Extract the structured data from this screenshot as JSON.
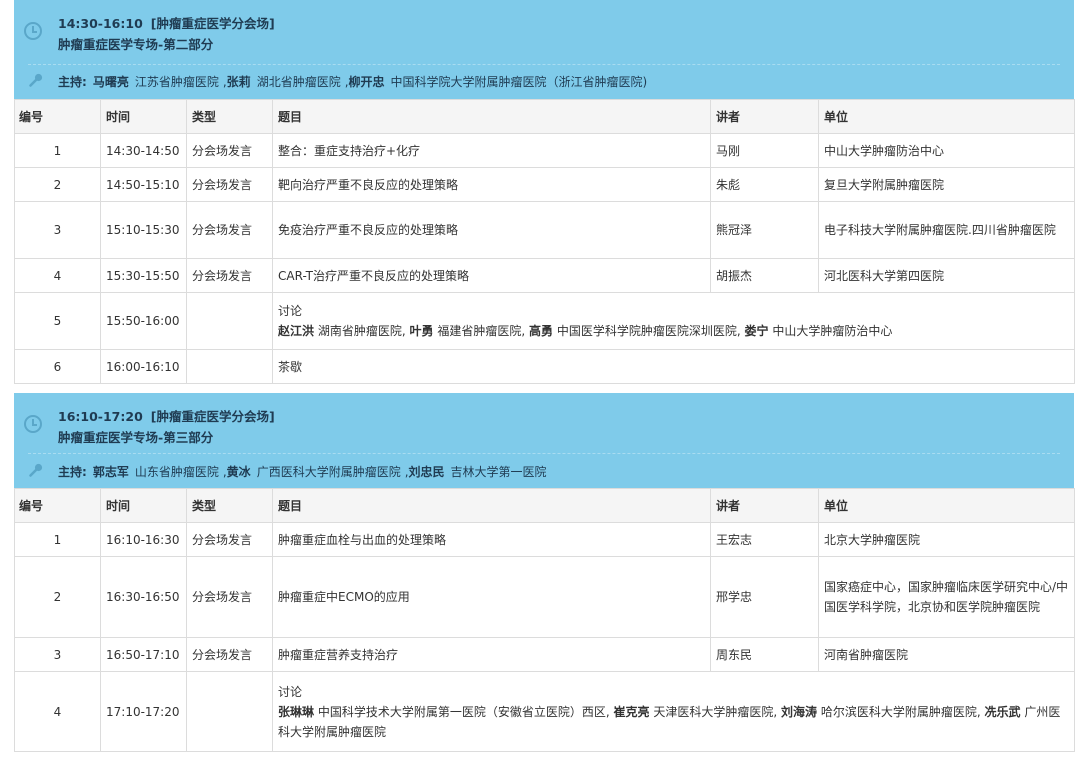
{
  "sessions": [
    {
      "time_range": "14:30-16:10",
      "venue": "[肿瘤重症医学分会场]",
      "subtitle": "肿瘤重症医学专场-第二部分",
      "host_label": "主持:",
      "hosts": [
        {
          "name": "马曙亮",
          "org": "江苏省肿瘤医院",
          "sep": ","
        },
        {
          "name": "张莉",
          "org": "湖北省肿瘤医院",
          "sep": ","
        },
        {
          "name": "柳开忠",
          "org": "中国科学院大学附属肿瘤医院（浙江省肿瘤医院)",
          "sep": ""
        }
      ],
      "headers": [
        "编号",
        "时间",
        "类型",
        "题目",
        "讲者",
        "单位"
      ],
      "rows": [
        {
          "no": "1",
          "time": "14:30-14:50",
          "type": "分会场发言",
          "topic": "整合：重症支持治疗+化疗",
          "speaker": "马刚",
          "org": "中山大学肿瘤防治中心"
        },
        {
          "no": "2",
          "time": "14:50-15:10",
          "type": "分会场发言",
          "topic": "靶向治疗严重不良反应的处理策略",
          "speaker": "朱彪",
          "org": "复旦大学附属肿瘤医院"
        },
        {
          "no": "3",
          "time": "15:10-15:30",
          "type": "分会场发言",
          "topic": "免疫治疗严重不良反应的处理策略",
          "speaker": "熊冠泽",
          "org": "电子科技大学附属肿瘤医院.四川省肿瘤医院"
        },
        {
          "no": "4",
          "time": "15:30-15:50",
          "type": "分会场发言",
          "topic": "CAR-T治疗严重不良反应的处理策略",
          "speaker": "胡振杰",
          "org": "河北医科大学第四医院"
        },
        {
          "no": "5",
          "time": "15:50-16:00",
          "type": "",
          "topic": "讨论",
          "speaker": "",
          "org": "",
          "discussants": [
            {
              "name": "赵江洪",
              "org": "湖南省肿瘤医院",
              "sep": ","
            },
            {
              "name": "叶勇",
              "org": "福建省肿瘤医院",
              "sep": ","
            },
            {
              "name": "高勇",
              "org": "中国医学科学院肿瘤医院深圳医院",
              "sep": ","
            },
            {
              "name": "娄宁",
              "org": "中山大学肿瘤防治中心",
              "sep": ""
            }
          ]
        },
        {
          "no": "6",
          "time": "16:00-16:10",
          "type": "",
          "topic": "茶歇",
          "speaker": "",
          "org": ""
        }
      ]
    },
    {
      "time_range": "16:10-17:20",
      "venue": "[肿瘤重症医学分会场]",
      "subtitle": "肿瘤重症医学专场-第三部分",
      "host_label": "主持:",
      "hosts": [
        {
          "name": "郭志军",
          "org": "山东省肿瘤医院",
          "sep": ","
        },
        {
          "name": "黄冰",
          "org": "广西医科大学附属肿瘤医院",
          "sep": ","
        },
        {
          "name": "刘忠民",
          "org": "吉林大学第一医院",
          "sep": ""
        }
      ],
      "headers": [
        "编号",
        "时间",
        "类型",
        "题目",
        "讲者",
        "单位"
      ],
      "rows": [
        {
          "no": "1",
          "time": "16:10-16:30",
          "type": "分会场发言",
          "topic": "肿瘤重症血栓与出血的处理策略",
          "speaker": "王宏志",
          "org": "北京大学肿瘤医院"
        },
        {
          "no": "2",
          "time": "16:30-16:50",
          "type": "分会场发言",
          "topic": "肿瘤重症中ECMO的应用",
          "speaker": "邢学忠",
          "org": "国家癌症中心，国家肿瘤临床医学研究中心/中国医学科学院，北京协和医学院肿瘤医院"
        },
        {
          "no": "3",
          "time": "16:50-17:10",
          "type": "分会场发言",
          "topic": "肿瘤重症营养支持治疗",
          "speaker": "周东民",
          "org": "河南省肿瘤医院"
        },
        {
          "no": "4",
          "time": "17:10-17:20",
          "type": "",
          "topic": "讨论",
          "speaker": "",
          "org": "",
          "discussants": [
            {
              "name": "张琳琳",
              "org": "中国科学技术大学附属第一医院（安徽省立医院）西区",
              "sep": ","
            },
            {
              "name": "崔克亮",
              "org": "天津医科大学肿瘤医院",
              "sep": ","
            },
            {
              "name": "刘海涛",
              "org": "哈尔滨医科大学附属肿瘤医院",
              "sep": ","
            },
            {
              "name": "冼乐武",
              "org": "广州医科大学附属肿瘤医院",
              "sep": ""
            }
          ]
        }
      ]
    }
  ]
}
